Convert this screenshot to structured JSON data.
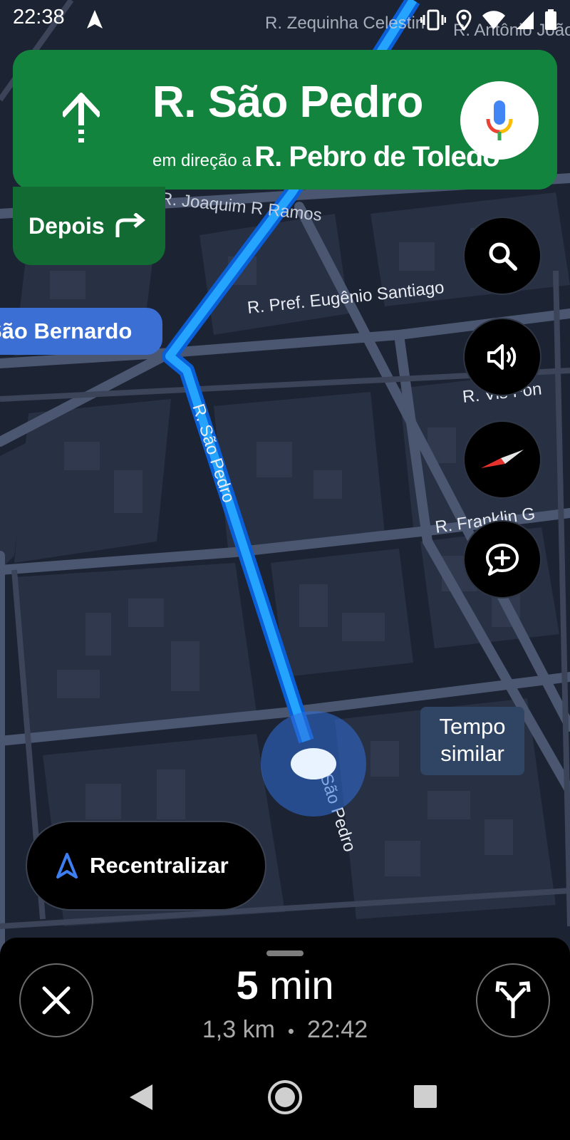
{
  "status_bar": {
    "time": "22:38",
    "icons": [
      "navigation-arrow-icon",
      "vibrate-icon",
      "location-icon",
      "wifi-icon",
      "signal-icon",
      "battery-icon"
    ]
  },
  "direction": {
    "street": "R. São Pedro",
    "towards_label": "em direção a",
    "towards_street": "R. Pebro de Toledo",
    "maneuver_icon": "straight-arrow-icon",
    "mic_icon": "google-mic-icon",
    "then_label": "Depois",
    "then_icon": "turn-right-icon",
    "card_color": "#13843e"
  },
  "map": {
    "streets": [
      "R. Zequinha Celestin",
      "R. Antônio João",
      "R. Joaquim R Ramos",
      "R. Pref. Eugênio Santiago",
      "R. São Pedro",
      "R. Franklin G",
      "R. Vis Fon"
    ],
    "place_label": "São Bernardo",
    "traffic_callout": [
      "Tempo",
      "similar"
    ],
    "route_color": "#1a8cff"
  },
  "map_controls": [
    {
      "name": "search-button",
      "icon": "search-icon"
    },
    {
      "name": "sound-button",
      "icon": "volume-icon"
    },
    {
      "name": "compass-button",
      "icon": "compass-icon"
    },
    {
      "name": "report-button",
      "icon": "add-report-icon"
    }
  ],
  "recenter": {
    "label": "Recentralizar",
    "icon": "navigation-arrow-icon"
  },
  "trip": {
    "duration_value": "5",
    "duration_unit": "min",
    "distance": "1,3 km",
    "separator": "•",
    "arrival": "22:42"
  },
  "bottom_buttons": {
    "close_icon": "close-icon",
    "routes_icon": "alternate-routes-icon"
  },
  "system_nav": [
    "back-icon",
    "home-icon",
    "recents-icon"
  ]
}
